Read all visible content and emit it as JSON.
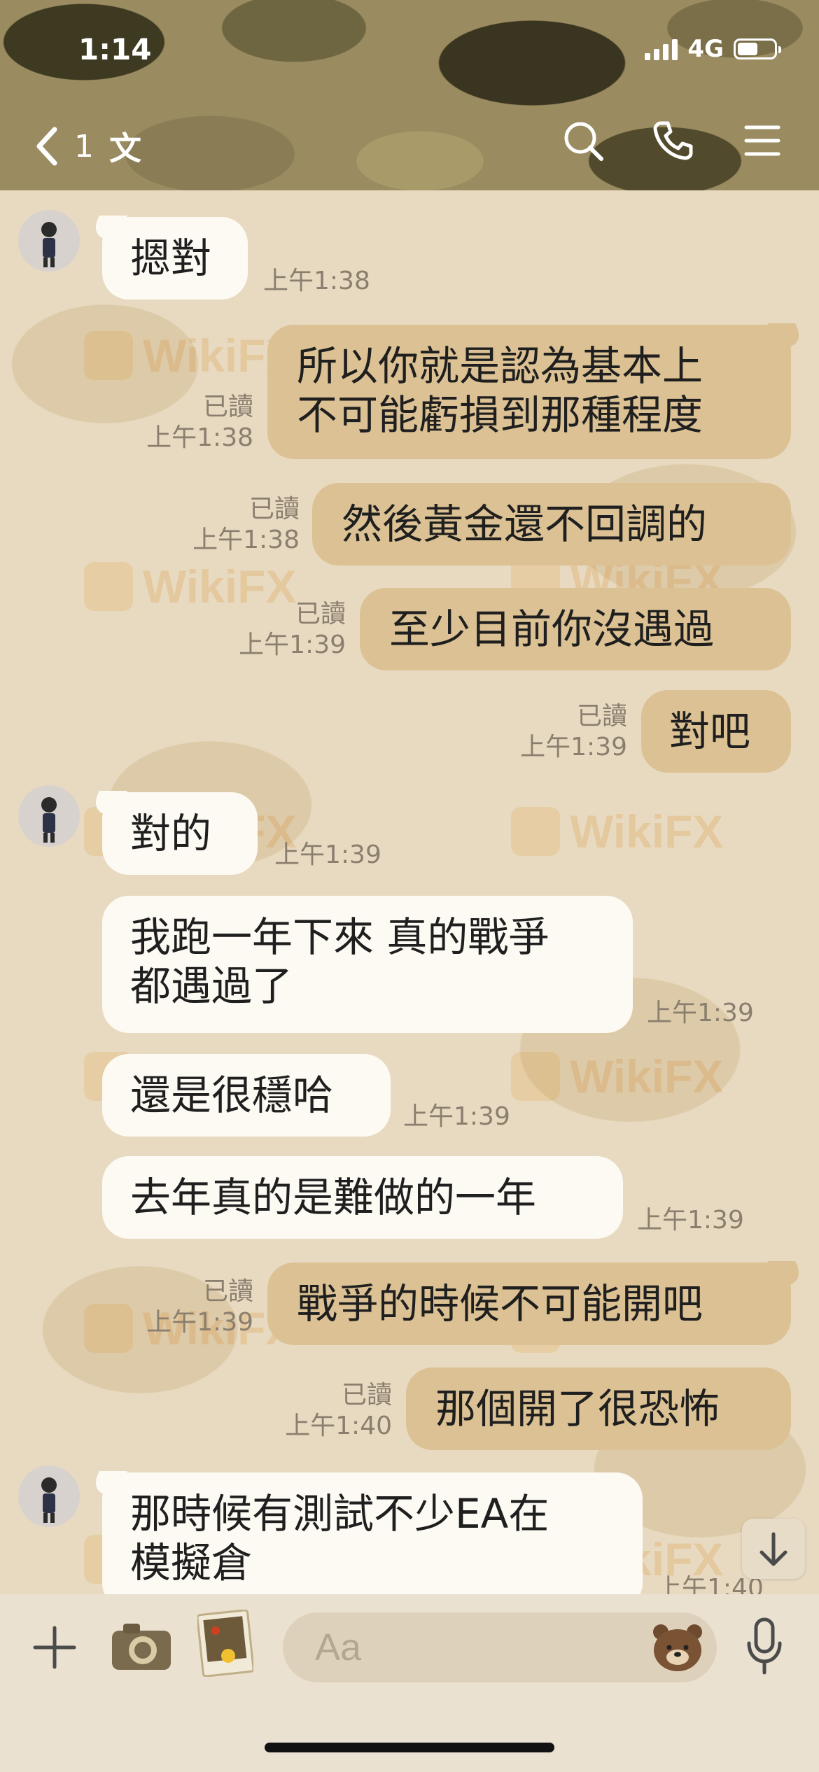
{
  "status_bar": {
    "time": "1:14",
    "network": "4G"
  },
  "header": {
    "back_count": "1",
    "title": "文"
  },
  "watermark": "WikiFX",
  "messages": [
    {
      "side": "in",
      "text": "摁對",
      "time": "上午1:38"
    },
    {
      "side": "out",
      "lines": [
        "所以你就是認為基本上",
        "不可能虧損到那種程度"
      ],
      "read": "已讀",
      "time": "上午1:38"
    },
    {
      "side": "out",
      "text": "然後黃金還不回調的",
      "read": "已讀",
      "time": "上午1:38"
    },
    {
      "side": "out",
      "text": "至少目前你沒遇過",
      "read": "已讀",
      "time": "上午1:39"
    },
    {
      "side": "out",
      "text": "對吧",
      "read": "已讀",
      "time": "上午1:39"
    },
    {
      "side": "in",
      "text": "對的",
      "time": "上午1:39"
    },
    {
      "side": "in",
      "lines": [
        "我跑一年下來 真的戰爭",
        "都遇過了"
      ],
      "time": "上午1:39"
    },
    {
      "side": "in",
      "text": "還是很穩哈",
      "time": "上午1:39"
    },
    {
      "side": "in",
      "text": "去年真的是難做的一年",
      "time": "上午1:39"
    },
    {
      "side": "out",
      "text": "戰爭的時候不可能開吧",
      "read": "已讀",
      "time": "上午1:39"
    },
    {
      "side": "out",
      "text": "那個開了很恐怖",
      "read": "已讀",
      "time": "上午1:40"
    },
    {
      "side": "in",
      "lines": [
        "那時候有測試不少EA在",
        "模擬倉"
      ],
      "time": "上午1:40"
    }
  ],
  "input": {
    "placeholder": "Aa"
  },
  "icons": {
    "back": "chevron-left-icon",
    "search": "search-icon",
    "call": "phone-icon",
    "menu": "menu-icon",
    "plus": "plus-icon",
    "camera": "camera-icon",
    "photo": "photo-icon",
    "emoji": "bear-sticker-icon",
    "mic": "microphone-icon",
    "scroll_down": "arrow-down-icon"
  },
  "colors": {
    "incoming_bubble": "#fdfaf3",
    "outgoing_bubble": "#dbc193",
    "background": "#e8dac1",
    "meta_text": "#8a7f6e"
  }
}
